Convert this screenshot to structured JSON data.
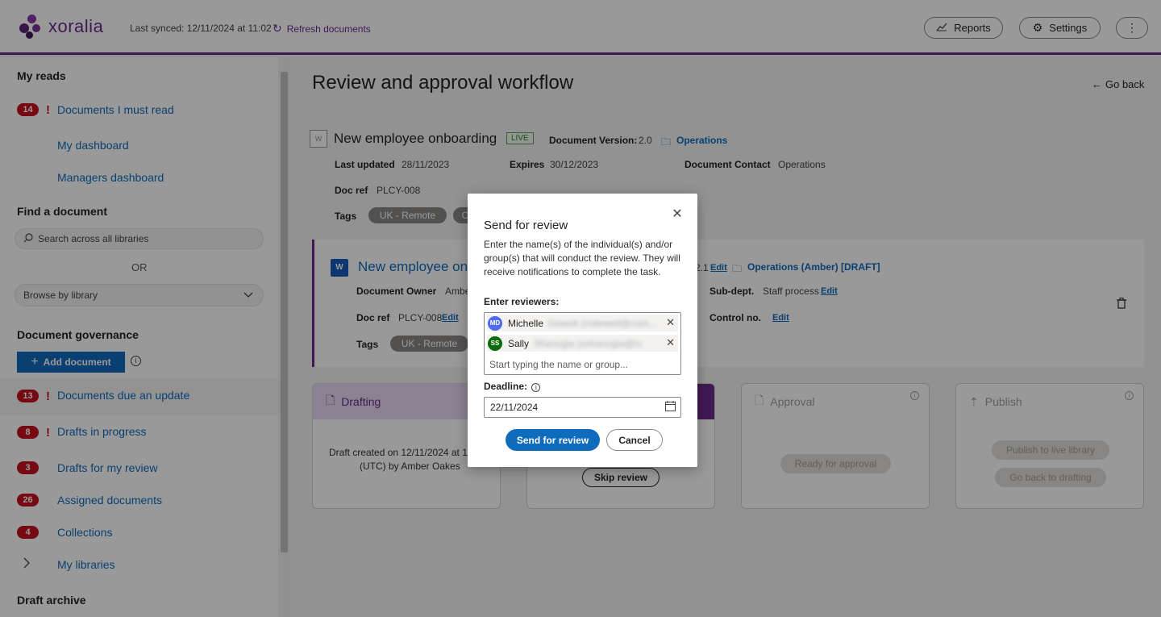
{
  "header": {
    "logo": "xoralia",
    "last_synced": "Last synced: 12/11/2024 at 11:02",
    "refresh": "Refresh documents",
    "reports": "Reports",
    "settings": "Settings",
    "more": "⋮"
  },
  "sidebar": {
    "my_reads": "My reads",
    "must_read": {
      "count": "14",
      "label": "Documents I must read"
    },
    "my_dashboard": "My dashboard",
    "managers_dashboard": "Managers dashboard",
    "find": "Find a document",
    "search_placeholder": "Search across all libraries",
    "or": "OR",
    "browse": "Browse by library",
    "governance": "Document governance",
    "add_document": "Add document",
    "items": [
      {
        "count": "13",
        "label": "Documents due an update",
        "alert": true
      },
      {
        "count": "8",
        "label": "Drafts in progress",
        "alert": true
      },
      {
        "count": "3",
        "label": "Drafts for my review"
      },
      {
        "count": "26",
        "label": "Assigned documents"
      },
      {
        "count": "4",
        "label": "Collections"
      }
    ],
    "my_libraries": "My libraries",
    "draft_archive": "Draft archive"
  },
  "main": {
    "title": "Review and approval workflow",
    "go_back": "Go back",
    "doc": {
      "name": "New employee onboarding",
      "status": "LIVE",
      "version_label": "Document Version:",
      "version": "2.0",
      "folder": "Operations",
      "last_updated_label": "Last updated",
      "last_updated": "28/11/2023",
      "expires_label": "Expires",
      "expires": "30/12/2023",
      "contact_label": "Document Contact",
      "contact": "Operations",
      "ref_label": "Doc ref",
      "ref": "PLCY-008",
      "tags_label": "Tags",
      "tag1": "UK - Remote",
      "tag2": "C"
    },
    "draft": {
      "name": "New employee on",
      "version_tail": "2.1",
      "edit": "Edit",
      "folder": "Operations (Amber) [DRAFT]",
      "owner_label": "Document Owner",
      "owner": "Ambe",
      "subdept_label": "Sub-dept.",
      "subdept": "Staff process",
      "ref_label": "Doc ref",
      "ref": "PLCY-008",
      "control_label": "Control no.",
      "tags_label": "Tags",
      "tag1": "UK - Remote"
    },
    "stages": {
      "drafting": {
        "title": "Drafting",
        "text1": "Draft created on 12/11/2024 at 11",
        "text2": "(UTC) by Amber Oakes"
      },
      "review": {
        "skip": "Skip review"
      },
      "approval": {
        "title": "Approval",
        "btn": "Ready for approval"
      },
      "publish": {
        "title": "Publish",
        "btn1": "Publish to live library",
        "btn2": "Go back to drafting"
      }
    }
  },
  "modal": {
    "title": "Send for review",
    "description": "Enter the name(s) of the individual(s) and/or group(s) that will conduct the review. They will receive notifications to complete the task.",
    "reviewers_label": "Enter reviewers:",
    "reviewers": [
      {
        "initials": "MD",
        "name": "Michelle",
        "email": "Dewett (mdewett@com...",
        "color": "#4f6bed"
      },
      {
        "initials": "SS",
        "name": "Sally",
        "email": "Shanugia (sshanugia@cont...",
        "color": "#0b6a0b"
      }
    ],
    "placeholder": "Start typing the name or group...",
    "deadline_label": "Deadline:",
    "deadline": "22/11/2024",
    "send": "Send for review",
    "cancel": "Cancel"
  }
}
